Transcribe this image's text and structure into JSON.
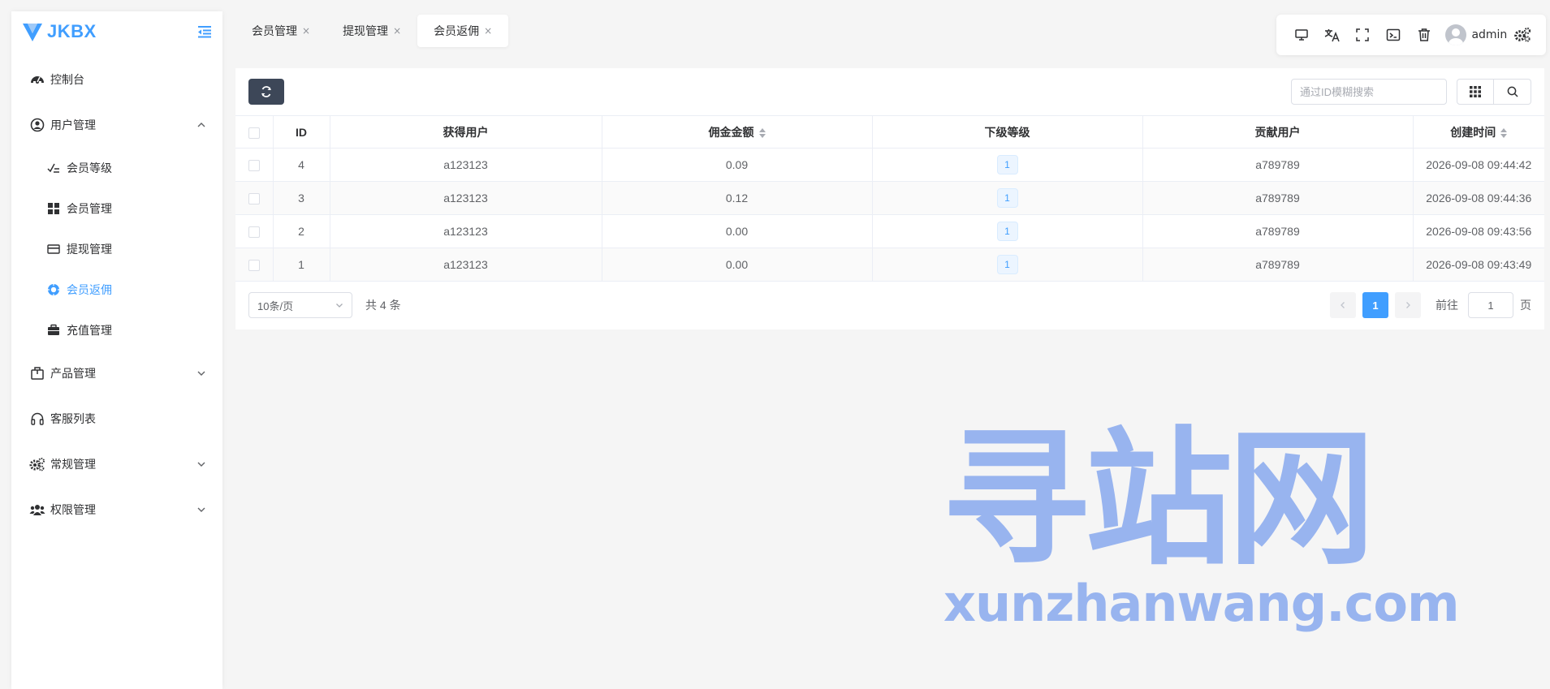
{
  "app": {
    "logo_text": "JKBX"
  },
  "sidebar": {
    "items": [
      {
        "label": "控制台",
        "icon": "dashboard-icon"
      },
      {
        "label": "用户管理",
        "icon": "user-circle-icon",
        "expanded": true,
        "children": [
          {
            "label": "会员等级",
            "icon": "level-icon"
          },
          {
            "label": "会员管理",
            "icon": "grid-icon"
          },
          {
            "label": "提现管理",
            "icon": "card-icon"
          },
          {
            "label": "会员返佣",
            "icon": "compass-icon",
            "active": true
          },
          {
            "label": "充值管理",
            "icon": "briefcase-icon"
          }
        ]
      },
      {
        "label": "产品管理",
        "icon": "package-icon"
      },
      {
        "label": "客服列表",
        "icon": "headset-icon"
      },
      {
        "label": "常规管理",
        "icon": "gears-icon"
      },
      {
        "label": "权限管理",
        "icon": "users-icon"
      }
    ]
  },
  "tabs": [
    {
      "label": "会员管理",
      "close": "×"
    },
    {
      "label": "提现管理",
      "close": "×"
    },
    {
      "label": "会员返佣",
      "close": "×",
      "active": true
    }
  ],
  "toolbar": {
    "username": "admin"
  },
  "search": {
    "placeholder": "通过ID模糊搜索"
  },
  "table": {
    "columns": [
      "ID",
      "获得用户",
      "佣金金额",
      "下级等级",
      "贡献用户",
      "创建时间"
    ],
    "rows": [
      {
        "id": "4",
        "user": "a123123",
        "amount": "0.09",
        "level": "1",
        "contributor": "a789789",
        "created": "2026-09-08 09:44:42"
      },
      {
        "id": "3",
        "user": "a123123",
        "amount": "0.12",
        "level": "1",
        "contributor": "a789789",
        "created": "2026-09-08 09:44:36"
      },
      {
        "id": "2",
        "user": "a123123",
        "amount": "0.00",
        "level": "1",
        "contributor": "a789789",
        "created": "2026-09-08 09:43:56"
      },
      {
        "id": "1",
        "user": "a123123",
        "amount": "0.00",
        "level": "1",
        "contributor": "a789789",
        "created": "2026-09-08 09:43:49"
      }
    ]
  },
  "pagination": {
    "page_size": "10条/页",
    "total": "共 4 条",
    "current": "1",
    "goto_prefix": "前往",
    "goto_value": "1",
    "goto_suffix": "页"
  },
  "watermark": {
    "big": "寻站网",
    "small": "xunzhanwang.com"
  },
  "colors": {
    "accent": "#409eff",
    "refresh_btn": "#3d4758",
    "watermark": "#98b4ef"
  }
}
